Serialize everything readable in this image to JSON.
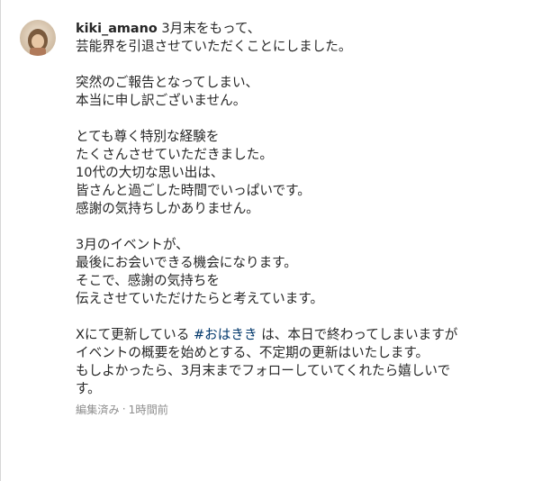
{
  "comment": {
    "username": "kiki_amano",
    "first_line": "3月末をもって、",
    "paragraphs": [
      {
        "lines": [
          "芸能界を引退させていただくことにしました。"
        ]
      },
      {
        "lines": [
          "突然のご報告となってしまい、",
          "本当に申し訳ございません。"
        ]
      },
      {
        "lines": [
          "とても尊く特別な経験を",
          "たくさんさせていただきました。",
          "10代の大切な思い出は、",
          "皆さんと過ごした時間でいっぱいです。",
          "感謝の気持ちしかありません。"
        ]
      },
      {
        "lines": [
          "3月のイベントが、",
          "最後にお会いできる機会になります。",
          "そこで、感謝の気持ちを",
          "伝えさせていただけたらと考えています。"
        ]
      }
    ],
    "final_paragraph": {
      "prefix": "Xにて更新している ",
      "hashtag": "#おはきき",
      "suffix": " は、本日で終わってしまいますが",
      "lines": [
        "イベントの概要を始めとする、不定期の更新はいたします。",
        "もしよかったら、3月末までフォローしていてくれたら嬉しいで",
        "す。"
      ]
    },
    "meta": {
      "edited": "編集済み",
      "separator": "·",
      "time": "1時間前"
    }
  },
  "colors": {
    "text": "#262626",
    "meta": "#8e8e8e",
    "hashtag": "#00376b"
  }
}
